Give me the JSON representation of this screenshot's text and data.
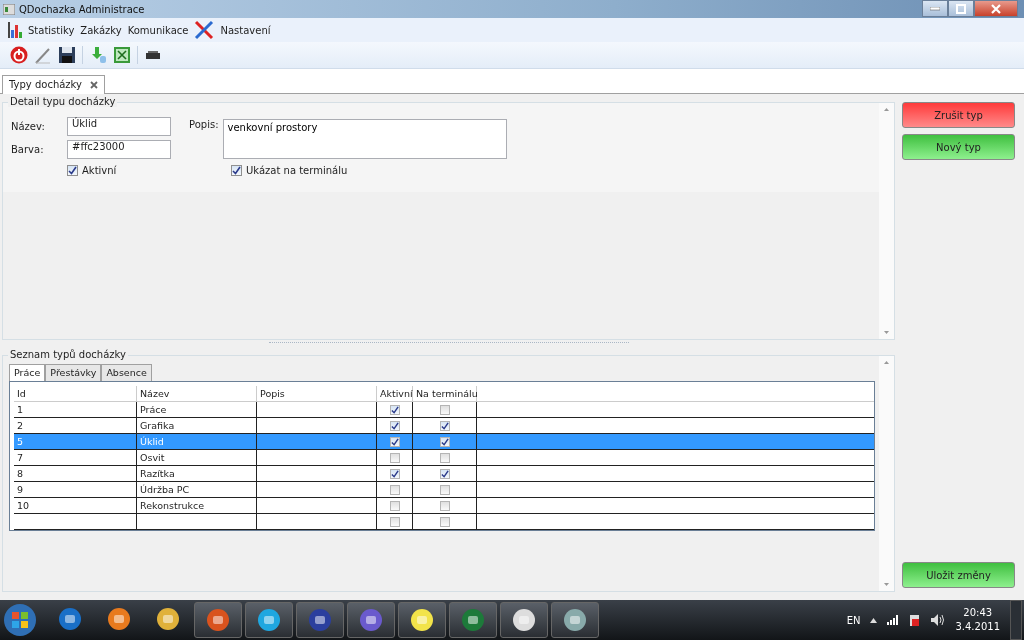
{
  "window": {
    "title": "QDochazka Administrace"
  },
  "menu": [
    {
      "kind": "chart"
    },
    {
      "label": "Statistiky"
    },
    {
      "label": "Zakázky"
    },
    {
      "label": "Komunikace"
    },
    {
      "kind": "tools"
    },
    {
      "label": "Nastavení"
    }
  ],
  "toolbar": [
    {
      "kind": "power"
    },
    {
      "kind": "edit"
    },
    {
      "kind": "save"
    },
    {
      "kind": "sep"
    },
    {
      "kind": "import"
    },
    {
      "kind": "excel"
    },
    {
      "kind": "sep"
    },
    {
      "kind": "printer"
    }
  ],
  "doc_tabs": [
    {
      "label": "Typy docházky",
      "selected": true
    }
  ],
  "detail": {
    "title": "Detail typu docházky",
    "fields": [
      {
        "label": "Název:",
        "value": "Úklid"
      },
      {
        "label": "Barva:",
        "value": "#ffc23000"
      }
    ],
    "description": {
      "label": "Popis:",
      "value": "venkovní prostory"
    },
    "checkboxes": [
      {
        "label": "Aktivní",
        "checked": true
      },
      {
        "label": "Ukázat na terminálu",
        "checked": true
      }
    ]
  },
  "list": {
    "title": "Seznam typů docházky",
    "tabs": [
      {
        "label": "Práce",
        "selected": true
      },
      {
        "label": "Přestávky",
        "selected": false
      },
      {
        "label": "Absence",
        "selected": false
      }
    ],
    "columns": [
      "Id",
      "Název",
      "Popis",
      "Aktivní",
      "Na terminálu"
    ],
    "rows": [
      {
        "id": "1",
        "name": "Práce",
        "active": true,
        "terminal": false,
        "selected": false
      },
      {
        "id": "2",
        "name": "Grafika",
        "active": true,
        "terminal": true,
        "selected": false
      },
      {
        "id": "5",
        "name": "Úklid",
        "active": true,
        "terminal": true,
        "selected": true
      },
      {
        "id": "7",
        "name": "Osvit",
        "active": false,
        "terminal": false,
        "selected": false
      },
      {
        "id": "8",
        "name": "Razítka",
        "active": true,
        "terminal": true,
        "selected": false
      },
      {
        "id": "9",
        "name": "Údržba PC",
        "active": false,
        "terminal": false,
        "selected": false
      },
      {
        "id": "10",
        "name": "Rekonstrukce",
        "active": false,
        "terminal": false,
        "selected": false
      },
      {
        "id": "",
        "name": "",
        "active": false,
        "terminal": false,
        "selected": false
      }
    ]
  },
  "actions": [
    {
      "label": "Zrušit typ",
      "kind": "danger"
    },
    {
      "label": "Nový typ",
      "kind": "ok"
    },
    {
      "label": "Uložit změny",
      "kind": "ok"
    }
  ],
  "taskbar": {
    "language": "EN",
    "time": "20:43",
    "date": "3.4.2011"
  }
}
